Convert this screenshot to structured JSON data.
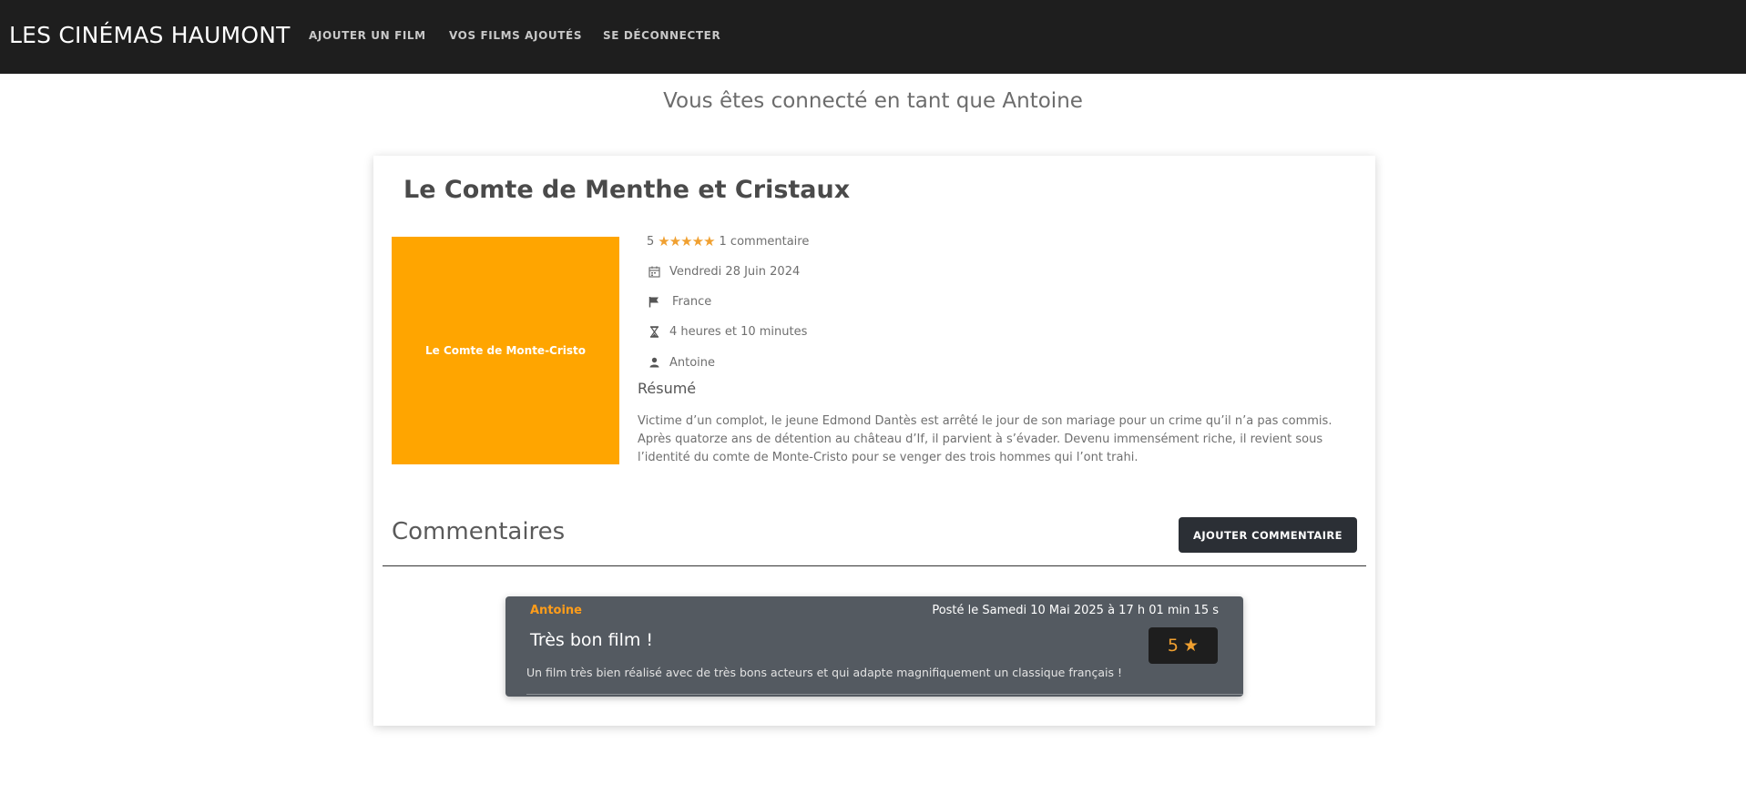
{
  "nav": {
    "brand": "LES CINÉMAS HAUMONT",
    "links": [
      "AJOUTER UN FILM",
      "VOS FILMS AJOUTÉS",
      "SE DÉCONNECTER"
    ]
  },
  "welcome": "Vous êtes connecté en tant que Antoine",
  "film": {
    "title": "Le Comte de Menthe et Cristaux",
    "poster_text": "Le Comte de Monte-Cristo",
    "rating": "5",
    "rating_stars": 5,
    "comments_count": "1 commentaire",
    "date": "Vendredi 28 Juin 2024",
    "country": "France",
    "duration": "4 heures et 10 minutes",
    "author": "Antoine",
    "resume_title": "Résumé",
    "resume": "Victime d’un complot, le jeune Edmond Dantès est arrêté le jour de son mariage pour un crime qu’il n’a pas commis. Après quatorze ans de détention au château d’If, il parvient à s’évader. Devenu immensément riche, il revient sous l’identité du comte de Monte-Cristo pour se venger des trois hommes qui l’ont trahi."
  },
  "comments": {
    "title": "Commentaires",
    "add_button": "AJOUTER COMMENTAIRE",
    "items": [
      {
        "author": "Antoine",
        "date": "Posté le Samedi 10 Mai 2025 à 17 h 01 min 15 s",
        "title": "Très bon film !",
        "rating": "5",
        "text": "Un film très bien réalisé avec de très bons acteurs et qui adapte magnifiquement un classique français !"
      }
    ]
  },
  "colors": {
    "navbar": "#1e1e1e",
    "poster": "#ffa500",
    "star": "#f0a030",
    "comment_card": "#545a61",
    "button": "#2b2f35"
  },
  "icons": [
    "calendar-icon",
    "flag-icon",
    "hourglass-icon",
    "user-icon",
    "star-icon"
  ]
}
